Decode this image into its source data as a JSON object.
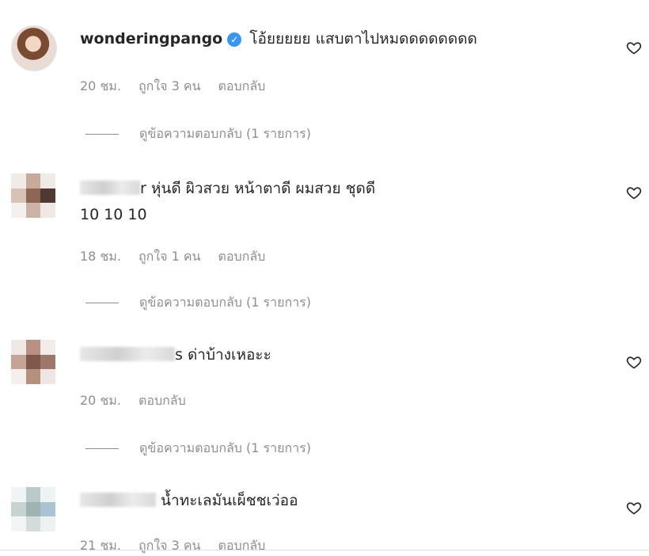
{
  "comments": [
    {
      "username": "wonderingpango",
      "verified": true,
      "text": "โอ้ยยยยย แสบตาไปหมดดดดดดดด",
      "time": "20 ชม.",
      "likes": "ถูกใจ 3 คน",
      "reply": "ตอบกลับ",
      "view_replies": "ดูข้อความตอบกลับ (1 รายการ)"
    },
    {
      "username_visible": "r",
      "text": "หุ่นดี ผิวสวย หน้าตาดี ผมสวย ชุดดี",
      "text_line2": "10 10 10",
      "time": "18 ชม.",
      "likes": "ถูกใจ 1 คน",
      "reply": "ตอบกลับ",
      "view_replies": "ดูข้อความตอบกลับ (1 รายการ)"
    },
    {
      "username_visible": "s",
      "text": "ด่าบ้างเหอะะ",
      "time": "20 ชม.",
      "reply": "ตอบกลับ",
      "view_replies": "ดูข้อความตอบกลับ (1 รายการ)"
    },
    {
      "text": "น้ำทะเลมันเผ็ชชเว่ออ",
      "time": "21 ชม.",
      "likes": "ถูกใจ 3 คน",
      "reply": "ตอบกลับ"
    }
  ],
  "icons": {
    "heart": "heart-outline-icon",
    "verified": "verified-badge-icon"
  },
  "colors": {
    "verified": "#3897f0",
    "meta": "#8e8e8e",
    "text": "#262626"
  }
}
